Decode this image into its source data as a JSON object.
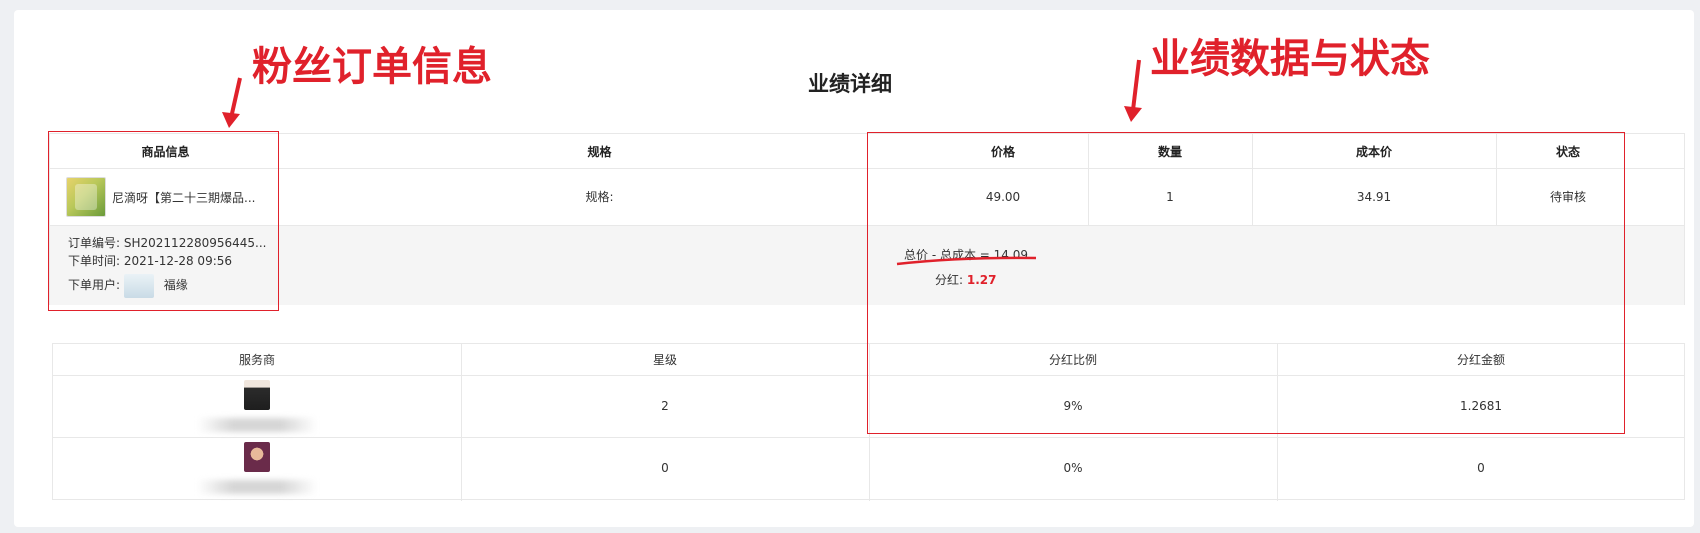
{
  "page_title": "业绩详细",
  "annotations": {
    "left_label": "粉丝订单信息",
    "right_label": "业绩数据与状态",
    "color": "#e0212b"
  },
  "order_table": {
    "headers": {
      "product_info": "商品信息",
      "spec": "规格",
      "price": "价格",
      "quantity": "数量",
      "cost_price": "成本价",
      "status": "状态"
    },
    "row": {
      "product_name": "尼滴呀【第二十三期爆品...",
      "spec": "规格:",
      "price": "49.00",
      "quantity": "1",
      "cost_price": "34.91",
      "status": "待审核"
    },
    "detail": {
      "order_no_label": "订单编号:",
      "order_no": "SH202112280956445...",
      "order_time_label": "下单时间:",
      "order_time": "2021-12-28 09:56",
      "order_user_label": "下单用户:",
      "order_user": "福缘",
      "formula": "总价 - 总成本 = 14.09",
      "dividend_label": "分红:",
      "dividend_value": "1.27"
    }
  },
  "service_table": {
    "headers": {
      "provider": "服务商",
      "level": "星级",
      "ratio": "分红比例",
      "amount": "分红金额"
    },
    "rows": [
      {
        "level": "2",
        "ratio": "9%",
        "amount": "1.2681"
      },
      {
        "level": "0",
        "ratio": "0%",
        "amount": "0"
      }
    ]
  }
}
